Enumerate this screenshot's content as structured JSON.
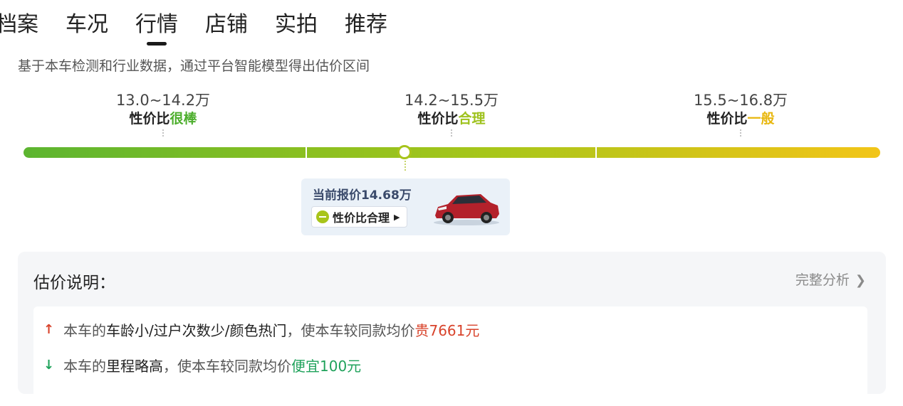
{
  "tabs": [
    {
      "label": "档案"
    },
    {
      "label": "车况"
    },
    {
      "label": "行情"
    },
    {
      "label": "店铺"
    },
    {
      "label": "实拍"
    },
    {
      "label": "推荐"
    }
  ],
  "active_tab": "行情",
  "intro": "基于本车检测和行业数据，通过平台智能模型得出估价区间",
  "segments": [
    {
      "range": "13.0~14.2万",
      "verdict_prefix": "性价比",
      "verdict": "很棒",
      "color": "#4cae2c"
    },
    {
      "range": "14.2~15.5万",
      "verdict_prefix": "性价比",
      "verdict": "合理",
      "color": "#9ec21d"
    },
    {
      "range": "15.5~16.8万",
      "verdict_prefix": "性价比",
      "verdict": "一般",
      "color": "#e8b70e"
    }
  ],
  "current_price": {
    "label": "当前报价14.68万",
    "pill": "性价比合理",
    "value_wan": 14.68
  },
  "price_scale": {
    "min": 13.0,
    "max": 16.8
  },
  "explanation": {
    "title": "估价说明：",
    "full_analysis": "完整分析",
    "reasons": [
      {
        "direction": "up",
        "prefix": "本车的",
        "factors": "车龄小/过户次数少/颜色热门",
        "middle": "，使本车较同款均价",
        "effect": "贵7661元",
        "color": "#d8432b"
      },
      {
        "direction": "down",
        "prefix": "本车的",
        "factors": "里程略高",
        "middle": "，使本车较同款均价",
        "effect": "便宜100元",
        "color": "#1fa25b"
      }
    ]
  }
}
